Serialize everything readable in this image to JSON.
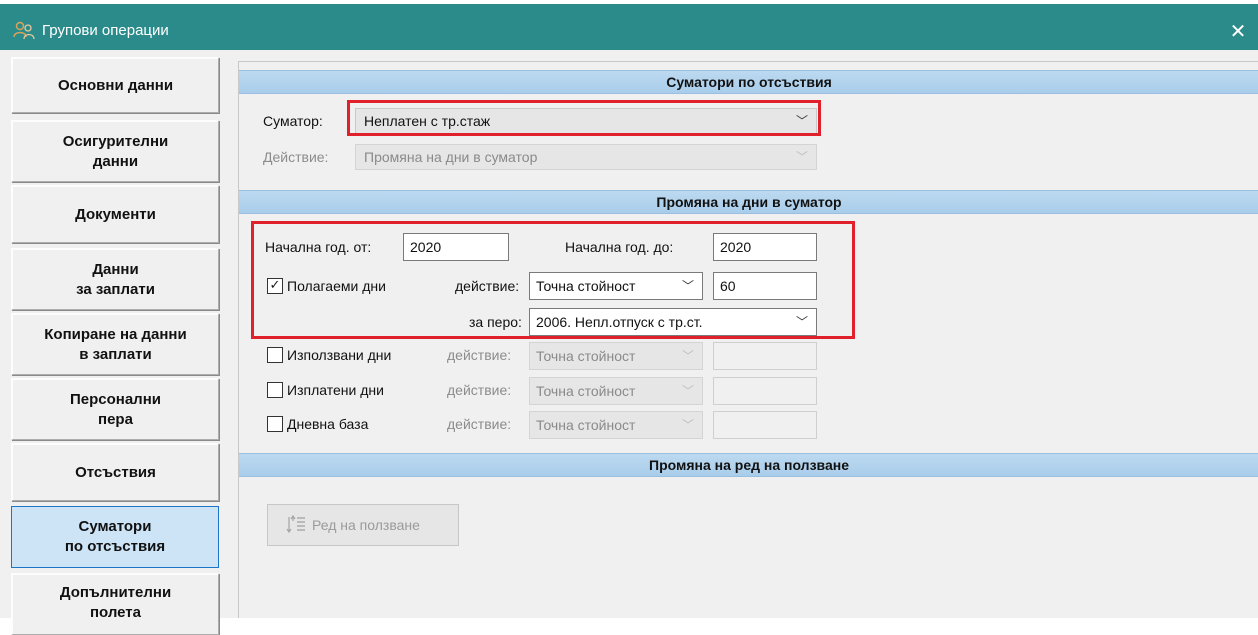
{
  "window": {
    "title": "Групови операции",
    "close_glyph": "✕",
    "icon": "people-group-icon"
  },
  "nav": {
    "items": [
      {
        "label": "Основни данни",
        "active": false
      },
      {
        "label": "Осигурителни\nданни",
        "active": false
      },
      {
        "label": "Документи",
        "active": false
      },
      {
        "label": "Данни\nза заплати",
        "active": false
      },
      {
        "label": "Копиране на данни\nв заплати",
        "active": false
      },
      {
        "label": "Персонални\nпера",
        "active": false
      },
      {
        "label": "Отсъствия",
        "active": false
      },
      {
        "label": "Суматори\nпо отсъствия",
        "active": true
      },
      {
        "label": "Допълнителни\nполета",
        "active": false
      }
    ]
  },
  "section1": {
    "header": "Суматори по отсъствия",
    "summator_label": "Суматор:",
    "summator_value": "Неплатен с тр.стаж",
    "action_label": "Действие:",
    "action_value": "Промяна на дни в суматор"
  },
  "section2": {
    "header": "Промяна на дни в суматор",
    "start_year_from_label": "Начална год. от:",
    "start_year_from_value": "2020",
    "start_year_to_label": "Начална год. до:",
    "start_year_to_value": "2020",
    "rows": [
      {
        "label": "Полагаеми дни",
        "checked": true,
        "check_glyph": "✓",
        "action_label": "действие:",
        "action_value": "Точна стойност",
        "amount": "60",
        "enabled": true
      },
      {
        "label": "Използвани дни",
        "checked": false,
        "check_glyph": "",
        "action_label": "действие:",
        "action_value": "Точна стойност",
        "amount": "",
        "enabled": false
      },
      {
        "label": "Изплатени дни",
        "checked": false,
        "check_glyph": "",
        "action_label": "действие:",
        "action_value": "Точна стойност",
        "amount": "",
        "enabled": false
      },
      {
        "label": "Дневна база",
        "checked": false,
        "check_glyph": "",
        "action_label": "действие:",
        "action_value": "Точна стойност",
        "amount": "",
        "enabled": false
      }
    ],
    "pay_item_label": "за перо:",
    "pay_item_value": "2006. Непл.отпуск с тр.ст."
  },
  "section3": {
    "header": "Промяна на ред на ползване",
    "order_button_label": "Ред на ползване",
    "order_icon": "sort-order-icon"
  },
  "colors": {
    "titlebar": "#2b8b8b",
    "section_header": "#a9cdea",
    "highlight": "#e0202a",
    "active_nav": "#cde4f7"
  }
}
